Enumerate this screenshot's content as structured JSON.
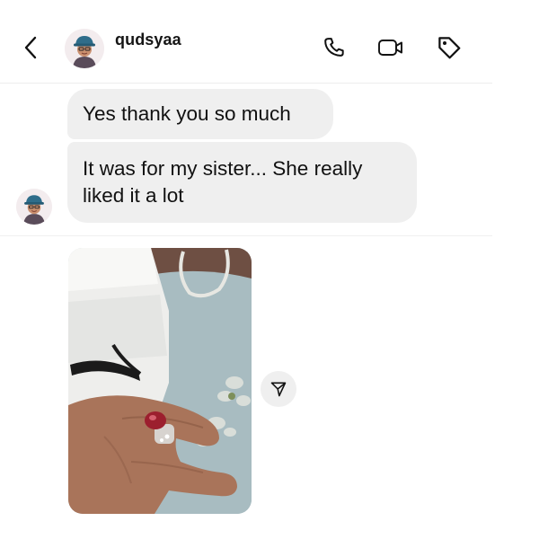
{
  "header": {
    "username": "qudsyaa",
    "icons": [
      "back-chevron-icon",
      "phone-icon",
      "video-camera-icon",
      "tag-icon"
    ]
  },
  "messages": [
    {
      "text": "Yes thank you so much"
    },
    {
      "text": "It was for my sister... She really liked it a lot"
    }
  ],
  "media": {
    "type": "photo",
    "subject": "hand wearing a red gemstone ring"
  },
  "colors": {
    "bubble": "#efefef",
    "divider": "#eeeeee",
    "text": "#111111"
  }
}
